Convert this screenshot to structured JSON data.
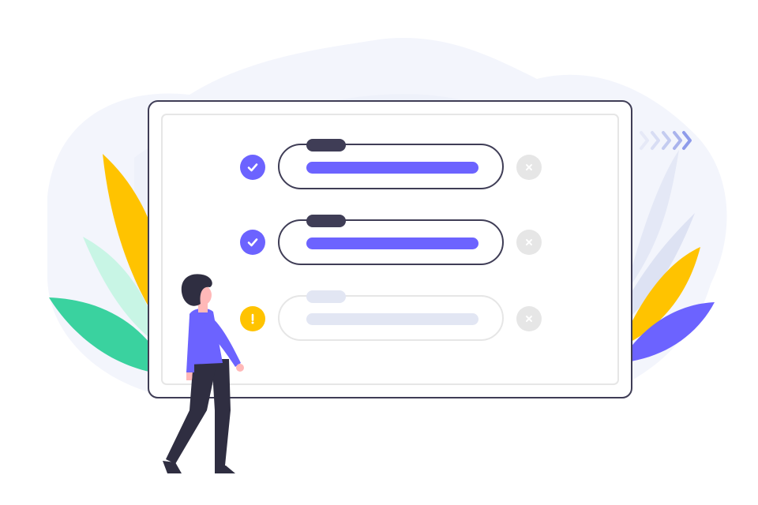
{
  "checklist": {
    "items": [
      {
        "status": "complete",
        "status_icon": "check-icon",
        "dismiss_icon": "close-icon"
      },
      {
        "status": "complete",
        "status_icon": "check-icon",
        "dismiss_icon": "close-icon"
      },
      {
        "status": "pending-warning",
        "status_icon": "exclamation-icon",
        "dismiss_icon": "close-icon"
      }
    ]
  },
  "colors": {
    "accent": "#6c63ff",
    "warning": "#ffc300",
    "dark": "#3f3d56",
    "muted": "#e2e6f3",
    "muted_border": "#e6e6e6",
    "leaf_green": "#3ad29f",
    "leaf_mint": "#c8f5e5",
    "leaf_yellow": "#ffc300",
    "blob_bg": "#f2f4fb",
    "dismiss_bg": "#e6e6e6"
  }
}
